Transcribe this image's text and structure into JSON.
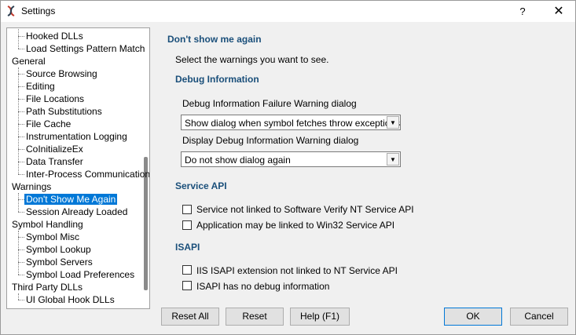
{
  "window": {
    "title": "Settings",
    "help_glyph": "?",
    "close_glyph": "✕"
  },
  "tree": {
    "items": [
      {
        "label": "Hooked DLLs",
        "level": 1,
        "selected": false
      },
      {
        "label": "Load Settings Pattern Match",
        "level": 1,
        "selected": false
      },
      {
        "label": "General",
        "level": 0,
        "selected": false
      },
      {
        "label": "Source Browsing",
        "level": 1,
        "selected": false
      },
      {
        "label": "Editing",
        "level": 1,
        "selected": false
      },
      {
        "label": "File Locations",
        "level": 1,
        "selected": false
      },
      {
        "label": "Path Substitutions",
        "level": 1,
        "selected": false
      },
      {
        "label": "File Cache",
        "level": 1,
        "selected": false
      },
      {
        "label": "Instrumentation Logging",
        "level": 1,
        "selected": false
      },
      {
        "label": "CoInitializeEx",
        "level": 1,
        "selected": false
      },
      {
        "label": "Data Transfer",
        "level": 1,
        "selected": false
      },
      {
        "label": "Inter-Process Communication",
        "level": 1,
        "selected": false
      },
      {
        "label": "Warnings",
        "level": 0,
        "selected": false
      },
      {
        "label": "Don't Show Me Again",
        "level": 1,
        "selected": true
      },
      {
        "label": "Session Already Loaded",
        "level": 1,
        "selected": false
      },
      {
        "label": "Symbol Handling",
        "level": 0,
        "selected": false
      },
      {
        "label": "Symbol Misc",
        "level": 1,
        "selected": false
      },
      {
        "label": "Symbol Lookup",
        "level": 1,
        "selected": false
      },
      {
        "label": "Symbol Servers",
        "level": 1,
        "selected": false
      },
      {
        "label": "Symbol Load Preferences",
        "level": 1,
        "selected": false
      },
      {
        "label": "Third Party DLLs",
        "level": 0,
        "selected": false
      },
      {
        "label": "UI Global Hook DLLs",
        "level": 1,
        "selected": false
      }
    ]
  },
  "panel": {
    "title": "Don't show me again",
    "intro": "Select the warnings you want to see.",
    "debug": {
      "heading": "Debug Information",
      "failure_label": "Debug Information Failure Warning dialog",
      "failure_value": "Show dialog when symbol fetches throw exceptions",
      "display_label": "Display Debug Information Warning dialog",
      "display_value": "Do not show dialog again"
    },
    "service": {
      "heading": "Service API",
      "cb1": "Service not linked to Software Verify NT Service API",
      "cb2": "Application may be linked to Win32 Service API"
    },
    "isapi": {
      "heading": "ISAPI",
      "cb1": "IIS ISAPI extension not linked to NT Service API",
      "cb2": "ISAPI has no debug information"
    }
  },
  "buttons": {
    "reset_all": "Reset All",
    "reset": "Reset",
    "help": "Help (F1)",
    "ok": "OK",
    "cancel": "Cancel"
  }
}
